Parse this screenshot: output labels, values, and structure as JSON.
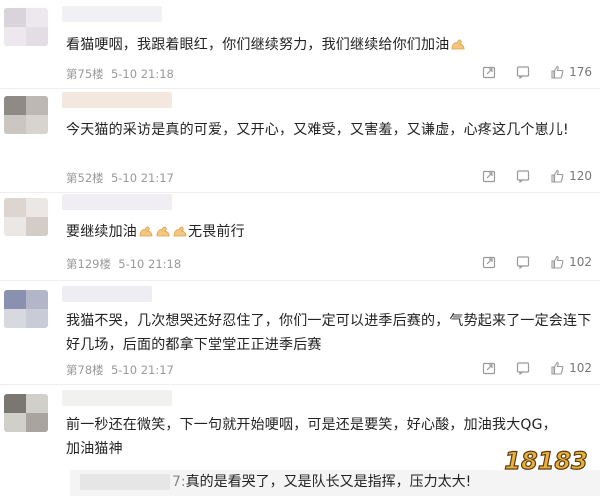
{
  "comments": [
    {
      "text": "看猫哽咽，我跟着眼红，你们继续努力，我们继续给你们加油",
      "emoji_count": 1,
      "floor": "第75楼",
      "date": "5-10 21:18",
      "likes": "176"
    },
    {
      "text": "今天猫的采访是真的可爱，又开心，又难受，又害羞，又谦虚，心疼这几个崽儿!",
      "emoji_count": 0,
      "floor": "第52楼",
      "date": "5-10 21:17",
      "likes": "120"
    },
    {
      "text": "要继续加油",
      "text_after": "无畏前行",
      "emoji_count": 3,
      "floor": "第129楼",
      "date": "5-10 21:18",
      "likes": "102"
    },
    {
      "text": "我猫不哭，几次想哭还好忍住了，你们一定可以进季后赛的，气势起来了一定会连下好几场，后面的都拿下堂堂正正进季后赛",
      "emoji_count": 0,
      "floor": "第78楼",
      "date": "5-10 21:17",
      "likes": "102"
    },
    {
      "text": "前一秒还在微笑，下一句就开始哽咽，可是还是要笑，好心酸，加油我大QG，加油猫神",
      "emoji_count": 0
    }
  ],
  "reply": {
    "prefix": "7:",
    "text": "真的是看哭了，又是队长又是指挥，压力太大!"
  },
  "watermark": "18183",
  "icons": [
    "share-icon",
    "comment-icon",
    "like-icon"
  ],
  "colors": {
    "meta": "#999999",
    "text": "#222222",
    "watermark_gold": "#e8b13a"
  }
}
